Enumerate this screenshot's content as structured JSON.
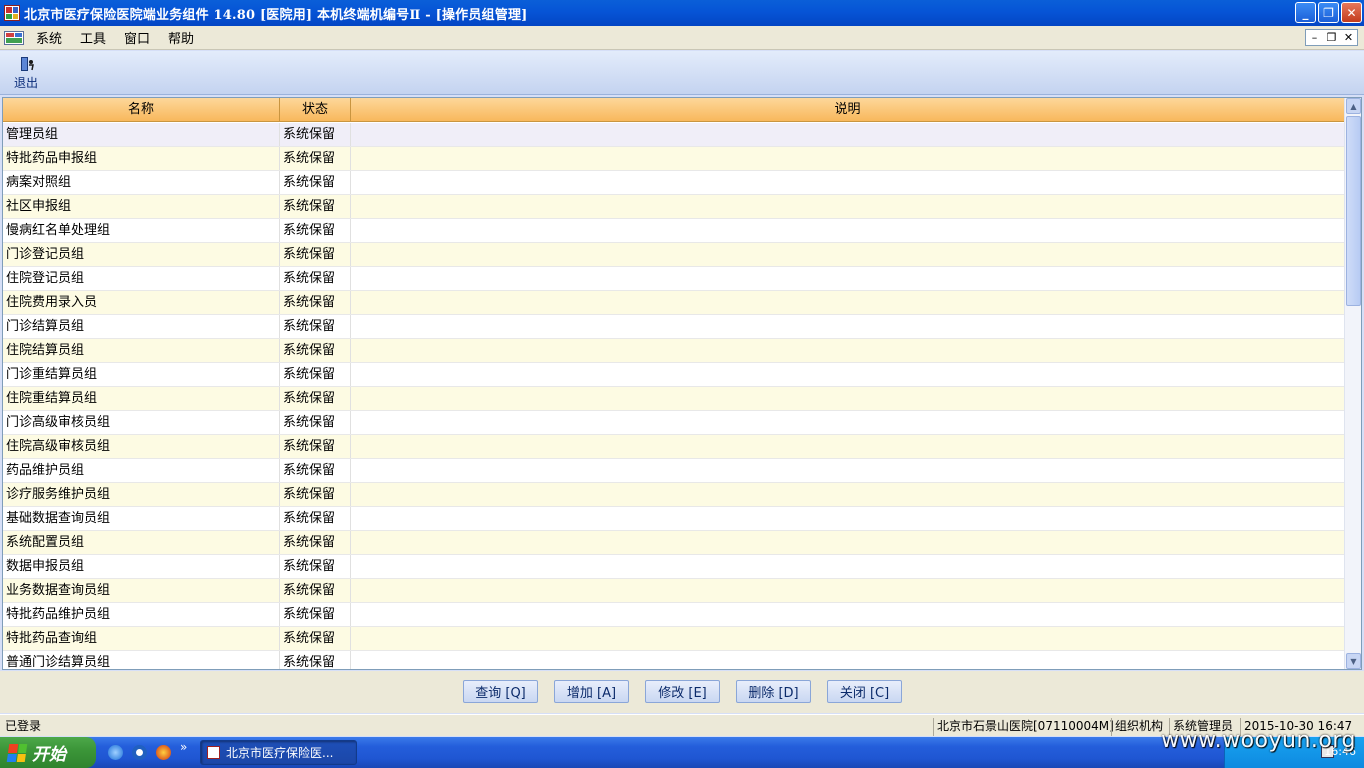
{
  "window": {
    "title": "北京市医疗保险医院端业务组件 14.80 [医院用] 本机终端机编号Ⅱ - [操作员组管理]",
    "controls": [
      "minimize",
      "restore",
      "close"
    ]
  },
  "menubar": {
    "items": [
      {
        "label": "系统"
      },
      {
        "label": "工具"
      },
      {
        "label": "窗口"
      },
      {
        "label": "帮助"
      }
    ]
  },
  "toolbar": {
    "exit_label": "退出"
  },
  "table": {
    "columns": [
      "名称",
      "状态",
      "说明"
    ],
    "rows": [
      {
        "name": "管理员组",
        "status": "系统保留",
        "desc": ""
      },
      {
        "name": "特批药品申报组",
        "status": "系统保留",
        "desc": ""
      },
      {
        "name": "病案对照组",
        "status": "系统保留",
        "desc": ""
      },
      {
        "name": "社区申报组",
        "status": "系统保留",
        "desc": ""
      },
      {
        "name": "慢病红名单处理组",
        "status": "系统保留",
        "desc": ""
      },
      {
        "name": "门诊登记员组",
        "status": "系统保留",
        "desc": ""
      },
      {
        "name": "住院登记员组",
        "status": "系统保留",
        "desc": ""
      },
      {
        "name": "住院费用录入员",
        "status": "系统保留",
        "desc": ""
      },
      {
        "name": "门诊结算员组",
        "status": "系统保留",
        "desc": ""
      },
      {
        "name": "住院结算员组",
        "status": "系统保留",
        "desc": ""
      },
      {
        "name": "门诊重结算员组",
        "status": "系统保留",
        "desc": ""
      },
      {
        "name": "住院重结算员组",
        "status": "系统保留",
        "desc": ""
      },
      {
        "name": "门诊高级审核员组",
        "status": "系统保留",
        "desc": ""
      },
      {
        "name": "住院高级审核员组",
        "status": "系统保留",
        "desc": ""
      },
      {
        "name": "药品维护员组",
        "status": "系统保留",
        "desc": ""
      },
      {
        "name": "诊疗服务维护员组",
        "status": "系统保留",
        "desc": ""
      },
      {
        "name": "基础数据查询员组",
        "status": "系统保留",
        "desc": ""
      },
      {
        "name": "系统配置员组",
        "status": "系统保留",
        "desc": ""
      },
      {
        "name": "数据申报员组",
        "status": "系统保留",
        "desc": ""
      },
      {
        "name": "业务数据查询员组",
        "status": "系统保留",
        "desc": ""
      },
      {
        "name": "特批药品维护员组",
        "status": "系统保留",
        "desc": ""
      },
      {
        "name": "特批药品查询组",
        "status": "系统保留",
        "desc": ""
      },
      {
        "name": "普通门诊结算员组",
        "status": "系统保留",
        "desc": ""
      }
    ]
  },
  "actions": {
    "query": "查询 [Q]",
    "add": "增加 [A]",
    "edit": "修改 [E]",
    "delete": "删除 [D]",
    "close": "关闭 [C]"
  },
  "statusbar": {
    "login_status": "已登录",
    "hospital": "北京市石景山医院[07110004M]",
    "org": "组织机构",
    "role": "系统管理员",
    "datetime": "2015-10-30 16:47"
  },
  "taskbar": {
    "start_label": "开始",
    "quicklaunch_more": "»",
    "task_label": "北京市医疗保险医...",
    "clock": "16:46"
  },
  "watermark": "www.wooyun.org",
  "colors": {
    "header_bg": "#f8b85c",
    "row_alt": "#fdfbe3",
    "title_bar": "#0654d6"
  }
}
